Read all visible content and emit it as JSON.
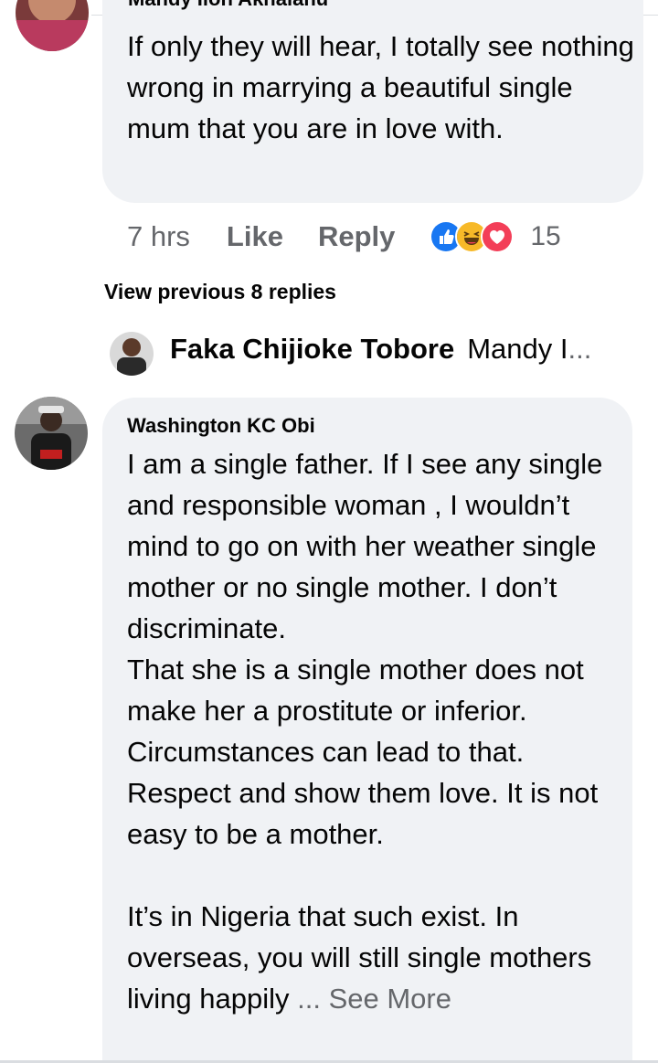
{
  "comment1": {
    "author_cut": "Mandy Iloh Akhalanu",
    "text": "If only they will hear, I totally see nothing wrong in marrying a beautiful single mum that you are in love with.",
    "time": "7 hrs",
    "like_label": "Like",
    "reply_label": "Reply",
    "reaction_icons": [
      "like-icon",
      "haha-icon",
      "love-icon"
    ],
    "reaction_count": "15"
  },
  "replies": {
    "view_previous_label": "View previous 8 replies",
    "latest_reply": {
      "author": "Faka Chijioke Tobore",
      "preview": "Mandy I",
      "ellipsis": "..."
    }
  },
  "comment2": {
    "author": "Washington KC Obi",
    "paragraphs": [
      "I am a single father.  If I see any single and responsible woman , I wouldn’t mind to go on with her weather single mother or no single mother.  I don’t discriminate.",
      "That she is a single mother does not make her a prostitute or inferior. Circumstances can lead to that.",
      "Respect and show them love. It is not easy to be a mother."
    ],
    "last_paragraph": "It’s in Nigeria that such exist. In overseas, you will still single mothers living happily",
    "see_more_ellipsis": " ...",
    "see_more_label": " See More"
  },
  "colors": {
    "bubble": "#f0f2f5",
    "secondary_text": "#65676b",
    "like_blue": "#1877f2",
    "haha_yellow": "#f7b928",
    "love_red": "#f33e58"
  }
}
